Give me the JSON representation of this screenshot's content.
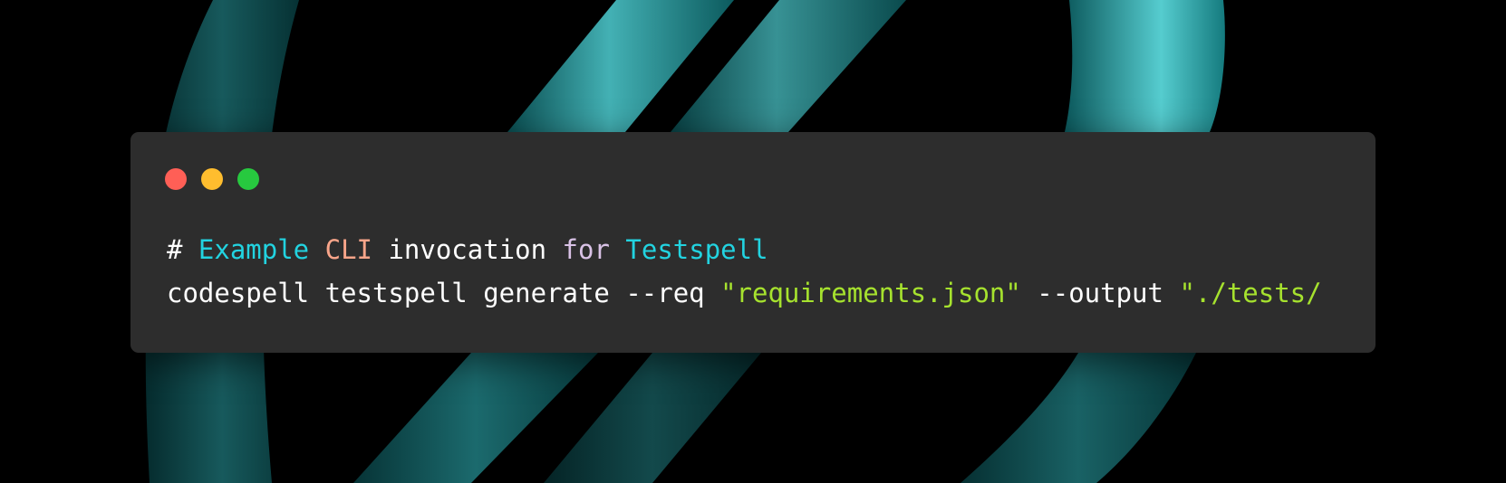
{
  "colors": {
    "window_bg": "#2d2d2d",
    "close_dot": "#ff5f56",
    "minimize_dot": "#ffbd2e",
    "maximize_dot": "#27c93f",
    "teal": "#22d3e0",
    "orange": "#f9a58a",
    "lavender": "#d9c2e6",
    "string_green": "#a6e22e"
  },
  "code": {
    "line1": {
      "hash": "# ",
      "example": "Example",
      "sp1": " ",
      "cli": "CLI",
      "sp2": " ",
      "invocation": "invocation",
      "sp3": " ",
      "for_kw": "for",
      "sp4": " ",
      "testspell": "Testspell"
    },
    "line2": {
      "command": "codespell testspell generate --req ",
      "req_value": "\"requirements.json\"",
      "output_flag": " --output ",
      "output_value": "\"./tests/"
    }
  }
}
